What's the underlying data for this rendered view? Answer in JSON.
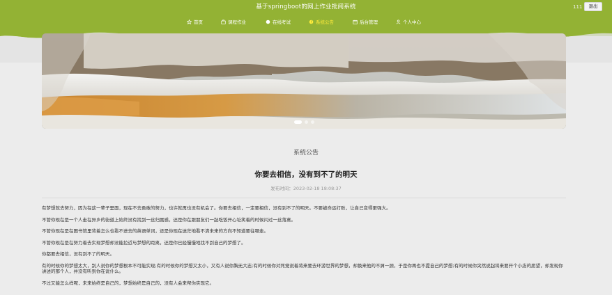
{
  "header": {
    "title": "基于springboot的网上作业批阅系统",
    "user": "111",
    "logout_label": "退出",
    "bg_color": "#93b234"
  },
  "nav": {
    "items": [
      {
        "label": "首页",
        "icon": "star-icon",
        "active": false
      },
      {
        "label": "课程作业",
        "icon": "briefcase-icon",
        "active": false
      },
      {
        "label": "在线考试",
        "icon": "circle-icon",
        "active": false
      },
      {
        "label": "系统公告",
        "icon": "info-circle-icon",
        "active": true
      },
      {
        "label": "后台管理",
        "icon": "calendar-icon",
        "active": false
      },
      {
        "label": "个人中心",
        "icon": "user-icon",
        "active": false
      }
    ],
    "active_color": "#ffeb3b"
  },
  "banner": {
    "description": "snowy landscape with river",
    "slides": 3,
    "active_slide": 1
  },
  "content": {
    "section_title": "系统公告",
    "article_title": "你要去相信，没有到不了的明天",
    "date": "发布时间：2023-02-18 18:08:37",
    "paragraphs": [
      "有梦想就去努力，因为在这一辈子里面，现在不去勇敢的努力，也许就再也没有机会了。你要去相信，一定要相信，没有到不了的明天。不要被命运打败，让自己变得更强大。",
      "不管你现在是一个人走在异乡的街道上始终没有找到一丝归属感，还是你在跟朋友们一起吃饭开心址笑着的时候闪过一丝落寞。",
      "不管你现在是在图书馆里背着怎么也看不进去的英语单词，还是你现在迷茫地看不清未来的方向不知道要往哪走。",
      "不管你现在是在努力着去实现梦想却没能拉近与梦想的距离，还是你已经慢慢地找不到自己的梦想了。",
      "你都要去相信，没有到不了的明天。",
      "有的时候你的梦想太大，别人说你的梦想根本不可能实现;有的时候你的梦想又太小，又有人说你胸无大志;有的时候你对死党说着将来要去环游世界的梦想，却换来他的不屑一顾，于是你再也不提自己的梦想;有的时候你突然说起将来要开个小店的愿望，却发现你讲述的那个人，并没有听到你在说什么。",
      "不过又能怎么样呢，未来始终是自己的，梦想始终是自己的，没有人会来帮你实现它。"
    ]
  }
}
